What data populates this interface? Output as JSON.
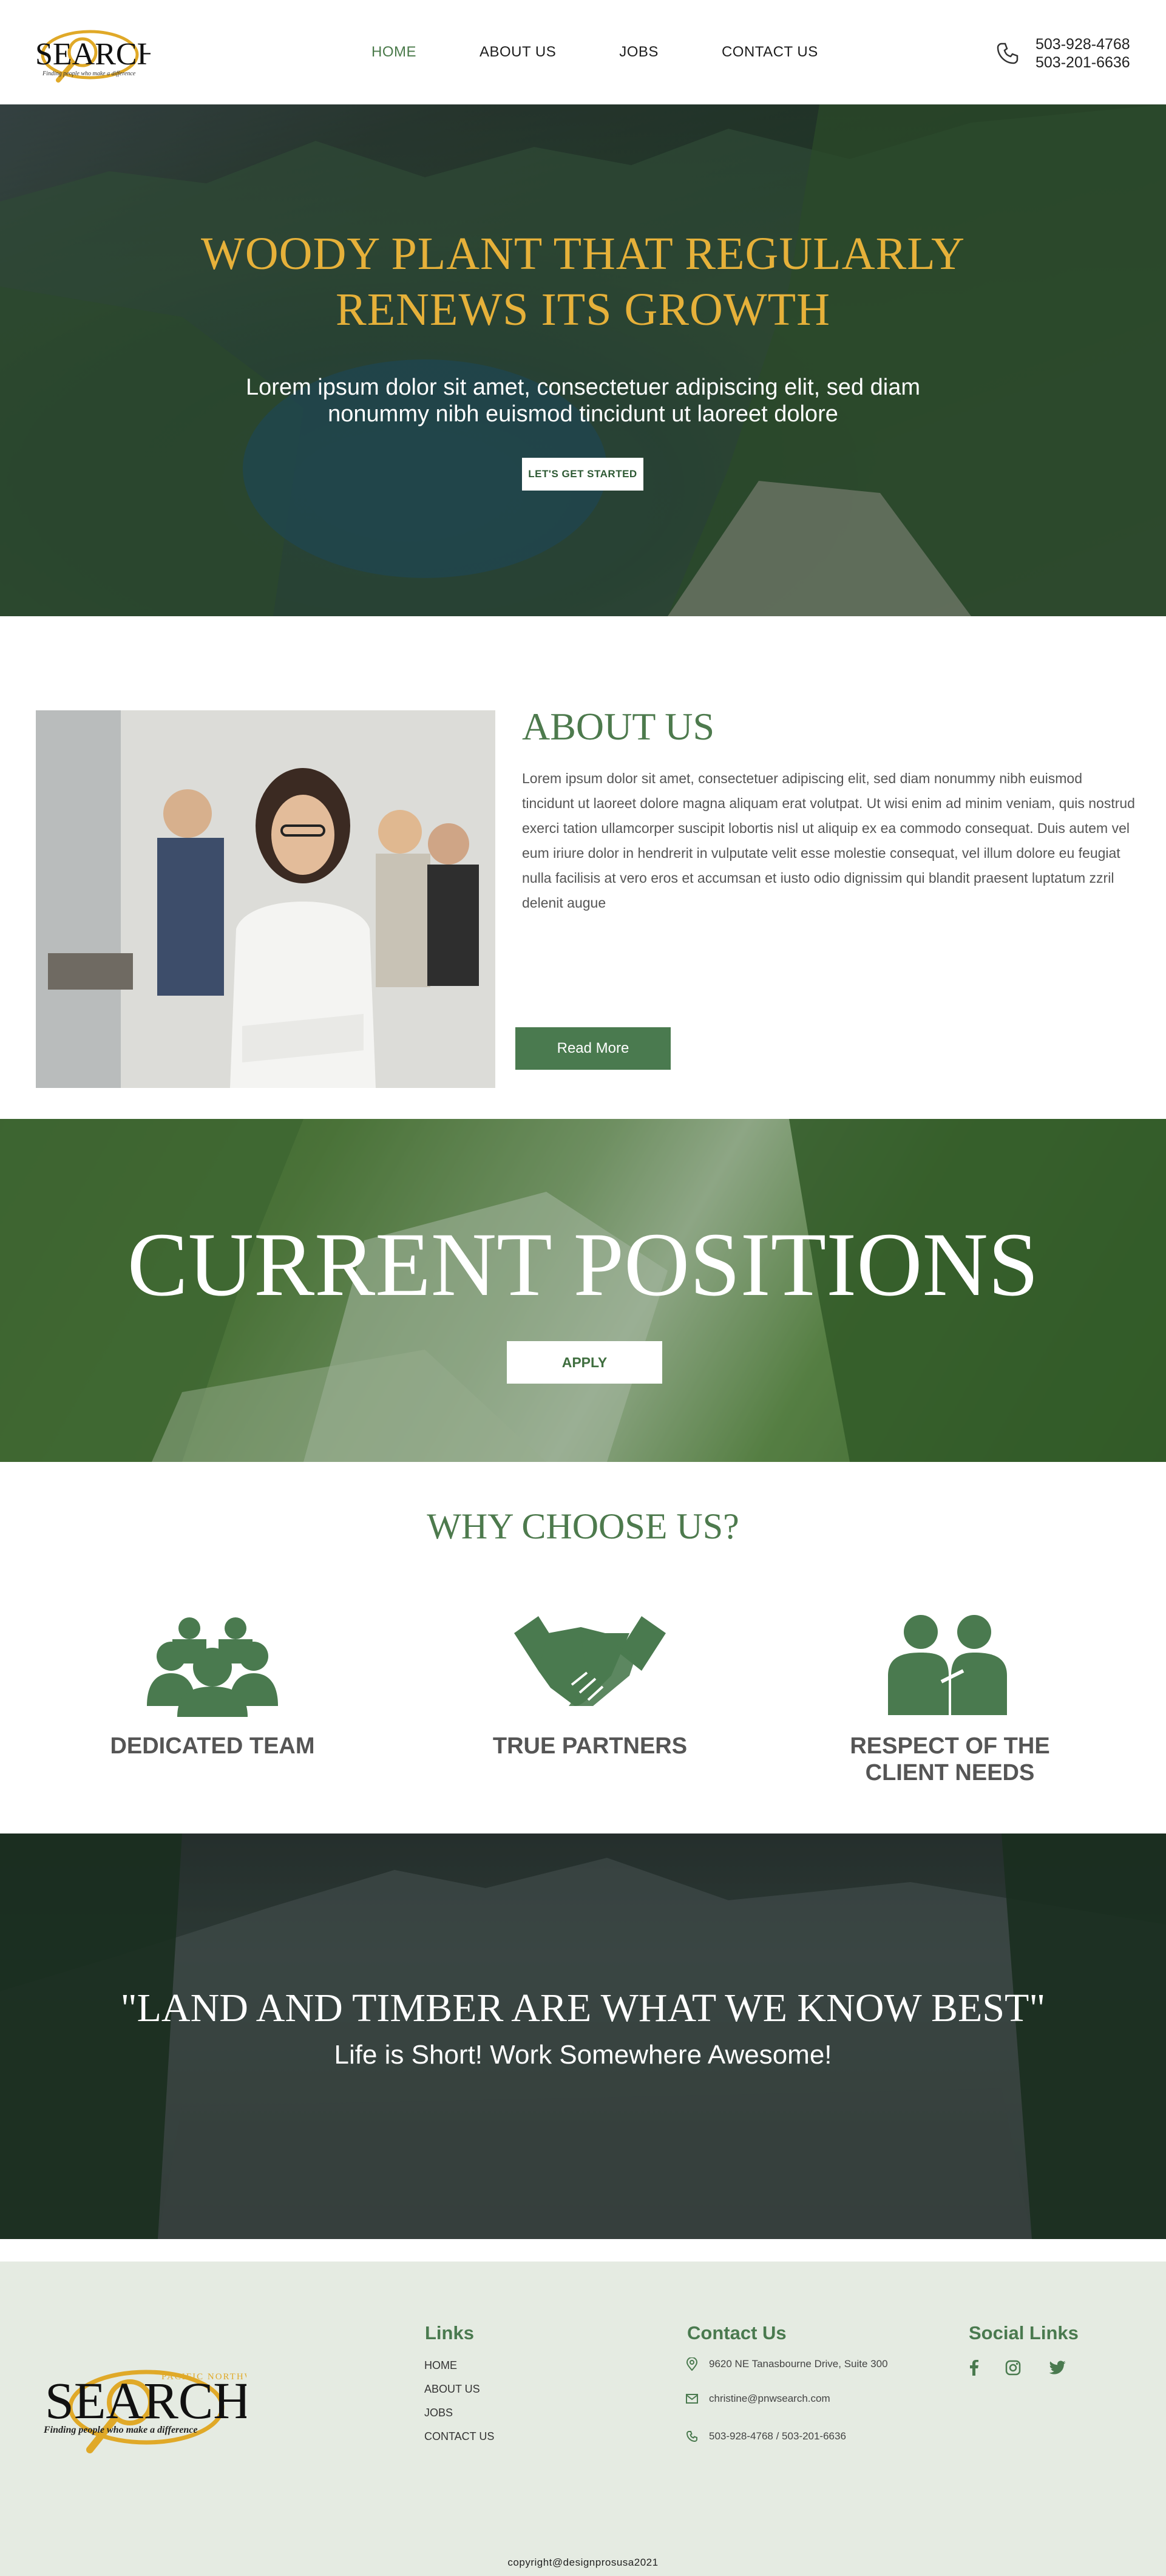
{
  "header": {
    "logo": {
      "text": "SEARCH",
      "tagline": "Finding people who make a difference",
      "icon": "magnifier-logo"
    },
    "nav": [
      {
        "label": "HOME",
        "active": true
      },
      {
        "label": "ABOUT US",
        "active": false
      },
      {
        "label": "JOBS",
        "active": false
      },
      {
        "label": "CONTACT US",
        "active": false
      }
    ],
    "phone_icon": "phone-icon",
    "phones": [
      "503-928-4768",
      "503-201-6636"
    ]
  },
  "hero": {
    "title_line1": "WOODY PLANT THAT REGULARLY",
    "title_line2": "RENEWS ITS GROWTH",
    "subtitle_line1": "Lorem ipsum dolor sit amet, consectetuer adipiscing elit, sed diam",
    "subtitle_line2": "nonummy nibh euismod tincidunt ut laoreet dolore",
    "button": "LET'S GET STARTED"
  },
  "about": {
    "title": "ABOUT US",
    "text": "Lorem ipsum dolor sit amet, consectetuer adipiscing elit, sed diam nonummy nibh euismod tincidunt ut laoreet dolore magna aliquam erat volutpat. Ut wisi enim ad minim veniam, quis nostrud exerci tation ullamcorper suscipit lobortis nisl ut aliquip ex ea commodo consequat. Duis autem vel eum iriure dolor in hendrerit in vulputate velit esse molestie consequat, vel illum dolore eu feugiat nulla facilisis at vero eros et accumsan et iusto odio dignissim qui blandit praesent luptatum zzril delenit augue",
    "button": "Read More"
  },
  "positions": {
    "title": "CURRENT POSITIONS",
    "button": "APPLY"
  },
  "why": {
    "title": "WHY CHOOSE US?",
    "features": [
      {
        "icon": "team-icon",
        "label_line1": "DEDICATED TEAM",
        "label_line2": ""
      },
      {
        "icon": "handshake-icon",
        "label_line1": "TRUE PARTNERS",
        "label_line2": ""
      },
      {
        "icon": "people-icon",
        "label_line1": "RESPECT OF THE",
        "label_line2": "CLIENT NEEDS"
      }
    ]
  },
  "quote": {
    "title": "\"LAND AND TIMBER ARE WHAT WE KNOW BEST\"",
    "subtitle": "Life is Short! Work Somewhere Awesome!"
  },
  "footer": {
    "logo": {
      "text": "SEARCH",
      "tagline_top": "PACIFIC NORTHWEST",
      "tagline": "Finding people who make a difference"
    },
    "links_title": "Links",
    "links": [
      "HOME",
      "ABOUT US",
      "JOBS",
      "CONTACT US"
    ],
    "contact_title": "Contact Us",
    "address": "9620 NE Tanasbourne Drive, Suite 300",
    "email": "christine@pnwsearch.com",
    "phones": "503-928-4768 / 503-201-6636",
    "social_title": "Social Links",
    "social": [
      "facebook-icon",
      "instagram-icon",
      "twitter-icon"
    ],
    "copyright": "copyright@designprosusa2021"
  },
  "colors": {
    "brand_green": "#4a7a4f",
    "gold": "#e6b13a",
    "footer_bg": "#e5ebe2"
  }
}
